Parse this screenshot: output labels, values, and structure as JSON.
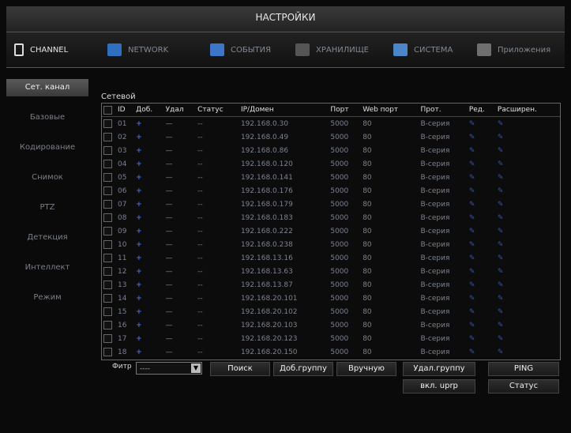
{
  "window": {
    "title": "НАСТРОЙКИ"
  },
  "tabs": [
    {
      "label": "CHANNEL",
      "active": true,
      "icon": "channel-icon",
      "color": "#e6e6e6"
    },
    {
      "label": "NETWORK",
      "icon": "network-icon"
    },
    {
      "label": "СОБЫТИЯ",
      "icon": "events-icon"
    },
    {
      "label": "ХРАНИЛИЩЕ",
      "icon": "storage-icon"
    },
    {
      "label": "СИСТЕМА",
      "icon": "system-icon"
    },
    {
      "label": "Приложения",
      "icon": "apps-icon"
    }
  ],
  "sidebar": {
    "items": [
      {
        "label": "Сет. канал",
        "active": true
      },
      {
        "label": "Базовые"
      },
      {
        "label": "Кодирование"
      },
      {
        "label": "Снимок"
      },
      {
        "label": "PTZ"
      },
      {
        "label": "Детекция"
      },
      {
        "label": "Интеллект"
      },
      {
        "label": "Режим"
      }
    ]
  },
  "main": {
    "group_label": "Сетевой",
    "columns": [
      "ID",
      "Доб.",
      "Удал",
      "Статус",
      "IP/Домен",
      "Порт",
      "Web порт",
      "Прот.",
      "Ред.",
      "Расширен."
    ],
    "rows": [
      {
        "id": "01",
        "status": "--",
        "ip": "192.168.0.30",
        "port": "5000",
        "web": "80",
        "proto": "B-серия"
      },
      {
        "id": "02",
        "status": "--",
        "ip": "192.168.0.49",
        "port": "5000",
        "web": "80",
        "proto": "B-серия"
      },
      {
        "id": "03",
        "status": "--",
        "ip": "192.168.0.86",
        "port": "5000",
        "web": "80",
        "proto": "B-серия"
      },
      {
        "id": "04",
        "status": "--",
        "ip": "192.168.0.120",
        "port": "5000",
        "web": "80",
        "proto": "B-серия"
      },
      {
        "id": "05",
        "status": "--",
        "ip": "192.168.0.141",
        "port": "5000",
        "web": "80",
        "proto": "B-серия"
      },
      {
        "id": "06",
        "status": "--",
        "ip": "192.168.0.176",
        "port": "5000",
        "web": "80",
        "proto": "B-серия"
      },
      {
        "id": "07",
        "status": "--",
        "ip": "192.168.0.179",
        "port": "5000",
        "web": "80",
        "proto": "B-серия"
      },
      {
        "id": "08",
        "status": "--",
        "ip": "192.168.0.183",
        "port": "5000",
        "web": "80",
        "proto": "B-серия"
      },
      {
        "id": "09",
        "status": "--",
        "ip": "192.168.0.222",
        "port": "5000",
        "web": "80",
        "proto": "B-серия"
      },
      {
        "id": "10",
        "status": "--",
        "ip": "192.168.0.238",
        "port": "5000",
        "web": "80",
        "proto": "B-серия"
      },
      {
        "id": "11",
        "status": "--",
        "ip": "192.168.13.16",
        "port": "5000",
        "web": "80",
        "proto": "B-серия"
      },
      {
        "id": "12",
        "status": "--",
        "ip": "192.168.13.63",
        "port": "5000",
        "web": "80",
        "proto": "B-серия"
      },
      {
        "id": "13",
        "status": "--",
        "ip": "192.168.13.87",
        "port": "5000",
        "web": "80",
        "proto": "B-серия"
      },
      {
        "id": "14",
        "status": "--",
        "ip": "192.168.20.101",
        "port": "5000",
        "web": "80",
        "proto": "B-серия"
      },
      {
        "id": "15",
        "status": "--",
        "ip": "192.168.20.102",
        "port": "5000",
        "web": "80",
        "proto": "B-серия"
      },
      {
        "id": "16",
        "status": "--",
        "ip": "192.168.20.103",
        "port": "5000",
        "web": "80",
        "proto": "B-серия"
      },
      {
        "id": "17",
        "status": "--",
        "ip": "192.168.20.123",
        "port": "5000",
        "web": "80",
        "proto": "B-серия"
      },
      {
        "id": "18",
        "status": "--",
        "ip": "192.168.20.150",
        "port": "5000",
        "web": "80",
        "proto": "B-серия"
      }
    ],
    "filter_label": "Фитр",
    "filter_value": "----",
    "buttons": {
      "search": "Поиск",
      "add_group": "Доб.группу",
      "manual": "Вручную",
      "delete_group": "Удал.группу",
      "ping": "PING",
      "enable_upnp": "вкл. uprp",
      "status": "Статус"
    }
  },
  "icons": {
    "add": "+",
    "delete": "—",
    "edit": "✎",
    "extend": "✎"
  },
  "colors": {
    "accent_blue": "#3a6fd8"
  }
}
